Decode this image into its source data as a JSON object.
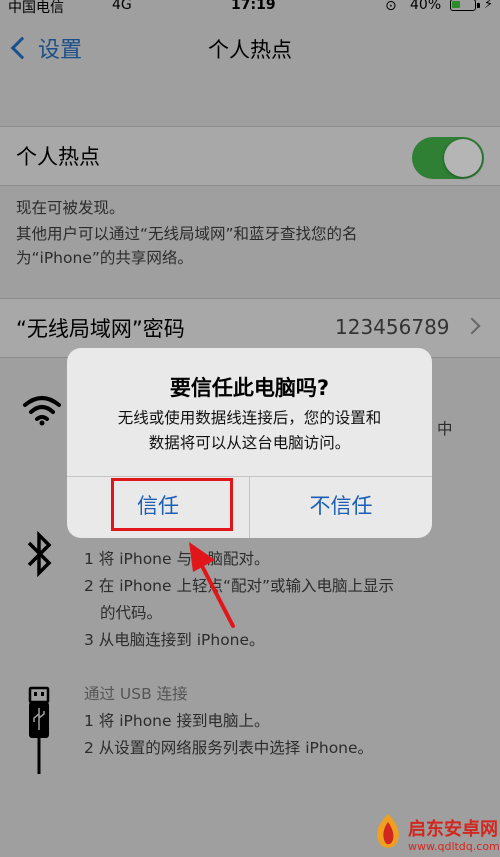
{
  "status_bar": {
    "carrier": "中国电信",
    "network": "4G",
    "time": "17:19",
    "battery_percent": "40%",
    "battery_level": 0.4
  },
  "nav": {
    "back_label": "设置",
    "title": "个人热点"
  },
  "hotspot": {
    "label": "个人热点",
    "enabled": true,
    "footer_line1": "现在可被发现。",
    "footer_line2": "其他用户可以通过“无线局域网”和蓝牙查找您的名",
    "footer_line3": "为“iPhone”的共享网络。"
  },
  "wifi_password": {
    "label": "“无线局域网”密码",
    "value": "123456789"
  },
  "wifi_partial": "中",
  "bluetooth": {
    "steps": [
      "1 将 iPhone 与电脑配对。",
      "2 在 iPhone 上轻点“配对”或输入电脑上显示",
      "的代码。",
      "3 从电脑连接到 iPhone。"
    ]
  },
  "usb": {
    "heading": "通过 USB 连接",
    "steps": [
      "1 将 iPhone 接到电脑上。",
      "2 从设置的网络服务列表中选择 iPhone。"
    ]
  },
  "alert": {
    "title": "要信任此电脑吗?",
    "message_line1": "无线或使用数据线连接后，您的设置和",
    "message_line2": "数据将可以从这台电脑访问。",
    "trust_label": "信任",
    "dont_trust_label": "不信任"
  },
  "watermark": {
    "name": "启东安卓网",
    "url": "www.qdltdq.com"
  },
  "colors": {
    "accent": "#1a5fb4",
    "toggle_on": "#2f7f35",
    "highlight": "#e0161b"
  }
}
